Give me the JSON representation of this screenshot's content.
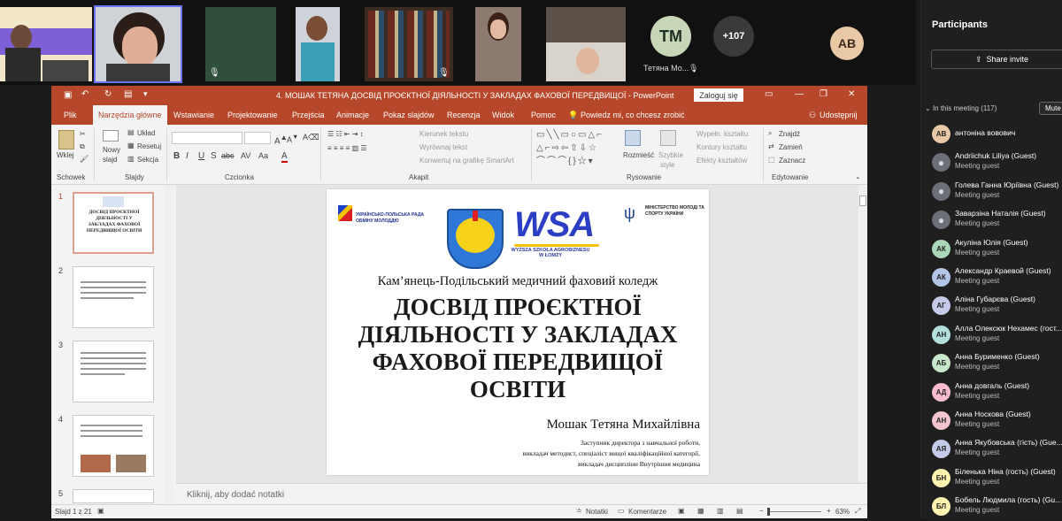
{
  "video_strip": {
    "tiles": [
      {
        "initials": "TM",
        "name": "Тетяна Мо..."
      },
      {
        "overflow": "+107"
      },
      {
        "initials": "AB"
      }
    ]
  },
  "panel": {
    "title": "Participants",
    "share_invite": "Share invite",
    "in_meeting": "In this meeting (117)",
    "mute_all": "Mute",
    "participants": [
      {
        "initials": "АВ",
        "name": "антоніна вовович",
        "role": "",
        "color": "#e9c8a6"
      },
      {
        "initials": "",
        "name": "Andriichuk Liliya (Guest)",
        "role": "Meeting guest",
        "color": "#cfcfd6"
      },
      {
        "initials": "",
        "name": "Голева Ганна Юріївна (Guest)",
        "role": "Meeting guest",
        "color": "#cfcfd6"
      },
      {
        "initials": "",
        "name": "Заварзіна Наталія (Guest)",
        "role": "Meeting guest",
        "color": "#cfcfd6"
      },
      {
        "initials": "АК",
        "name": "Акуліна Юлія (Guest)",
        "role": "Meeting guest",
        "color": "#a9d7b8"
      },
      {
        "initials": "АК",
        "name": "Александр Краевой (Guest)",
        "role": "Meeting guest",
        "color": "#b4c6e7"
      },
      {
        "initials": "АГ",
        "name": "Аліна Губарєва (Guest)",
        "role": "Meeting guest",
        "color": "#c5cae9"
      },
      {
        "initials": "АН",
        "name": "Алла Олексюк Нехамес (гост...",
        "role": "Meeting guest",
        "color": "#b2dfdb"
      },
      {
        "initials": "АБ",
        "name": "Анна Бурименко (Guest)",
        "role": "Meeting guest",
        "color": "#c8e6c9"
      },
      {
        "initials": "АД",
        "name": "Анна довгаль (Guest)",
        "role": "Meeting guest",
        "color": "#f8bbd0"
      },
      {
        "initials": "АН",
        "name": "Анна Носкова (Guest)",
        "role": "Meeting guest",
        "color": "#f3c6cf"
      },
      {
        "initials": "АЯ",
        "name": "Анна Якубовська (гість) (Gue...",
        "role": "Meeting guest",
        "color": "#c5cae9"
      },
      {
        "initials": "БН",
        "name": "Біленька Ніна (гость) (Guest)",
        "role": "Meeting guest",
        "color": "#fff3b0"
      },
      {
        "initials": "БЛ",
        "name": "Бобель Людмила (гость) (Gu...",
        "role": "Meeting guest",
        "color": "#fff3b0"
      }
    ]
  },
  "ppt": {
    "title": "4. МОШАК ТЕТЯНА ДОСВІД ПРОЄКТНОЇ ДІЯЛЬНОСТІ У ЗАКЛАДАХ ФАХОВОЇ ПЕРЕДВИЩОЇ  -  PowerPoint",
    "login": "Zaloguj się",
    "tabs": [
      "Plik",
      "Narzędzia główne",
      "Wstawianie",
      "Projektowanie",
      "Przejścia",
      "Animacje",
      "Pokaz slajdów",
      "Recenzja",
      "Widok",
      "Pomoc",
      "Powiedz mi, co chcesz zrobić",
      "Udostępnij"
    ],
    "ribbon": {
      "clipboard": {
        "paste": "Wklej",
        "label": "Schowek"
      },
      "slides": {
        "new_slide": "Nowy",
        "new_slide2": "slajd",
        "layout": "Układ",
        "reset": "Resetuj",
        "section": "Sekcja",
        "label": "Slajdy"
      },
      "font": {
        "label": "Czcionka",
        "b": "B",
        "i": "I",
        "u": "U",
        "s": "S",
        "av": "AV",
        "aa": "Aa",
        "a": "A"
      },
      "paragraph": {
        "text_dir": "Kierunek tekstu",
        "align": "Wyrównaj tekst",
        "smartart": "Konwertuj na grafikę SmartArt",
        "label": "Akapit"
      },
      "drawing": {
        "arrange": "Rozmieść",
        "quick": "Szybkie",
        "quick2": "style",
        "fill": "Wypełn. kształtu",
        "outline": "Kontury kształtu",
        "effects": "Efekty kształtów",
        "label": "Rysowanie"
      },
      "editing": {
        "find": "Znajdź",
        "replace": "Zamień",
        "select": "Zaznacz",
        "label": "Edytowanie"
      }
    },
    "thumbnails": [
      {
        "num": "1",
        "title": "ДОСВІД ПРОЄКТНОЇ ДІЯЛЬНОСТІ У ЗАКЛАДАХ ФАХОВОЇ ПЕРЕДВИЩОЇ ОСВІТИ"
      },
      {
        "num": "2"
      },
      {
        "num": "3"
      },
      {
        "num": "4"
      },
      {
        "num": "5"
      }
    ],
    "slide": {
      "org_left": "УКРАЇНСЬКО-ПОЛЬСЬКА РАДА ОБМІНУ МОЛОДДЮ",
      "wsa": "WSA",
      "wsa_sub": "WYŻSZA SZKOŁA AGROBIZNESU W ŁOMŻY",
      "org_right": "МІНІСТЕРСТВО МОЛОДІ ТА СПОРТУ УКРАЇНИ",
      "college": "Кам’янець-Подільський медичний фаховий коледж",
      "title": "ДОСВІД ПРОЄКТНОЇ ДІЯЛЬНОСТІ У ЗАКЛАДАХ ФАХОВОЇ ПЕРЕДВИЩОЇ ОСВІТИ",
      "author": "Мошак Тетяна Михайлівна",
      "position1": "Заступник директора з навчальної роботи,",
      "position2": "викладач методист, спеціаліст вищої кваліфікаційної категорії,",
      "position3": "викладач дисципліни Внутрішня медицина"
    },
    "notes_placeholder": "Kliknij, aby dodać notatki",
    "status": {
      "slide_count": "Slajd 1 z 21",
      "notes": "Notatki",
      "comments": "Komentarze",
      "zoom": "63%"
    }
  }
}
